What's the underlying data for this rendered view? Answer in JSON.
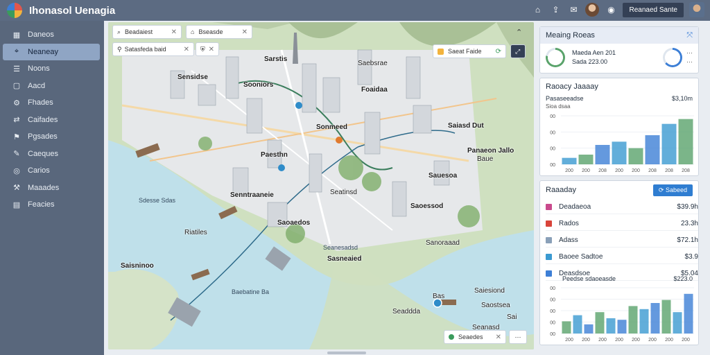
{
  "app": {
    "title": "Ihonasol Uenagia"
  },
  "header": {
    "user_button": "Reanaed Sante"
  },
  "sidebar": {
    "items": [
      {
        "label": "Daneos",
        "icon": "grid-icon",
        "active": false
      },
      {
        "label": "Neaneay",
        "icon": "map-pin-icon",
        "active": true
      },
      {
        "label": "Noons",
        "icon": "layers-icon",
        "active": false
      },
      {
        "label": "Aacd",
        "icon": "square-icon",
        "active": false
      },
      {
        "label": "Fhades",
        "icon": "gear-icon",
        "active": false
      },
      {
        "label": "Caifades",
        "icon": "route-icon",
        "active": false
      },
      {
        "label": "Pgsades",
        "icon": "pin-icon",
        "active": false
      },
      {
        "label": "Caeques",
        "icon": "chat-icon",
        "active": false
      },
      {
        "label": "Carios",
        "icon": "eye-icon",
        "active": false
      },
      {
        "label": "Maaades",
        "icon": "tool-icon",
        "active": false
      },
      {
        "label": "Feacies",
        "icon": "chart-icon",
        "active": false
      }
    ]
  },
  "map": {
    "chips": {
      "search1": "Beadaiest",
      "search2": "Bseasde",
      "filter": "Satasfeda baid",
      "pin": "Saeat Faide"
    },
    "labels": [
      "Sensidse",
      "Sooniors",
      "Sarstis",
      "Foaidaa",
      "Sonmeed",
      "Saiasd Dut",
      "Paesthn",
      "Panaeon Jallo",
      "Baue",
      "Sauesoa",
      "Senntraaneie",
      "Saoessod",
      "Saoaedos",
      "Sanoraaad",
      "Sasneaied",
      "Saisninoo",
      "Saiesiond",
      "Bas",
      "Saostsea",
      "Seaddda",
      "Seanasd",
      "Sai",
      "Seatinsd",
      "Saebsrae",
      "Riatiles"
    ],
    "water_labels": [
      "Sdesse Sdas",
      "Baebatine Ba",
      "Seanesadsd"
    ],
    "bottom_chip": "Seaedes"
  },
  "panels": {
    "metrics": {
      "title": "Meaing Roeas",
      "line1": "Maeda Aen 201",
      "line2": "Sada 223.00",
      "ring1_value": 0.78,
      "ring2_value": 0.64,
      "ring_color": "#5aa36b",
      "ring2_color": "#3d7fd6"
    },
    "chart1": {
      "title": "Raoacy Jaaaay",
      "subtitle": "Pasaseeadse",
      "value": "$3,10m",
      "note": "Sioa dsaa"
    },
    "list": {
      "title": "Raaaday",
      "button": "Sabeed",
      "rows": [
        {
          "label": "Deadaeoa",
          "value": "$39.9h",
          "color": "#c94a8d"
        },
        {
          "label": "Rados",
          "value": "23.3h",
          "color": "#d9443a"
        },
        {
          "label": "Adass",
          "value": "$72.1h",
          "color": "#8aa0b8"
        },
        {
          "label": "Baoee Sadtoe",
          "value": "$3.9",
          "color": "#3b9ad1"
        },
        {
          "label": "Deasdsoe",
          "value": "$5.04",
          "color": "#3d7fd6"
        }
      ],
      "chart_title": "Peedse sdaoeasde",
      "chart_value": "$223.0"
    }
  },
  "chart_data": [
    {
      "type": "bar",
      "categories": [
        "200",
        "200",
        "208",
        "200",
        "200",
        "208",
        "208",
        "208"
      ],
      "values": [
        40,
        60,
        120,
        140,
        100,
        180,
        250,
        280
      ],
      "ylim": [
        0,
        300
      ],
      "yticks": [
        "00",
        "00",
        "00",
        "00"
      ],
      "colors": [
        "#3b9ad1",
        "#5aa36b",
        "#3d7fd6"
      ]
    },
    {
      "type": "bar",
      "categories": [
        "200",
        "200",
        "200",
        "200",
        "200",
        "200",
        "200",
        "200"
      ],
      "values": [
        80,
        120,
        60,
        140,
        100,
        90,
        180,
        160,
        200,
        220,
        140,
        260
      ],
      "ylim": [
        0,
        300
      ],
      "yticks": [
        "00",
        "00",
        "00",
        "00",
        "00"
      ],
      "colors": [
        "#5aa36b",
        "#3b9ad1",
        "#3d7fd6"
      ]
    }
  ]
}
